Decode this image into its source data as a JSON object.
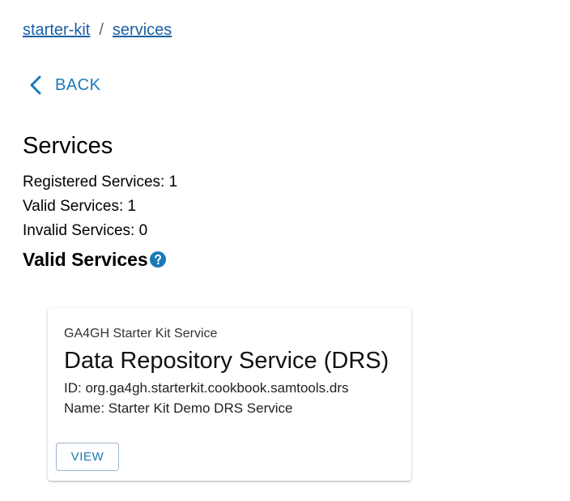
{
  "breadcrumb": {
    "items": [
      "starter-kit",
      "services"
    ],
    "separator": "/"
  },
  "back": {
    "label": "BACK",
    "icon": "chevron-left-icon"
  },
  "page": {
    "title": "Services"
  },
  "stats": {
    "registered": "Registered Services: 1",
    "valid": "Valid Services: 1",
    "invalid": "Invalid Services: 0"
  },
  "section": {
    "title": "Valid Services",
    "help_icon": "help-circle-icon"
  },
  "cards": [
    {
      "overline": "GA4GH Starter Kit Service",
      "title": "Data Repository Service (DRS)",
      "id_line": "ID: org.ga4gh.starterkit.cookbook.samtools.drs",
      "name_line": "Name: Starter Kit Demo DRS Service",
      "button_label": "VIEW"
    }
  ],
  "colors": {
    "link": "#1a5fa3",
    "accent": "#1a7ab8",
    "help_icon": "#1a7ab8"
  }
}
